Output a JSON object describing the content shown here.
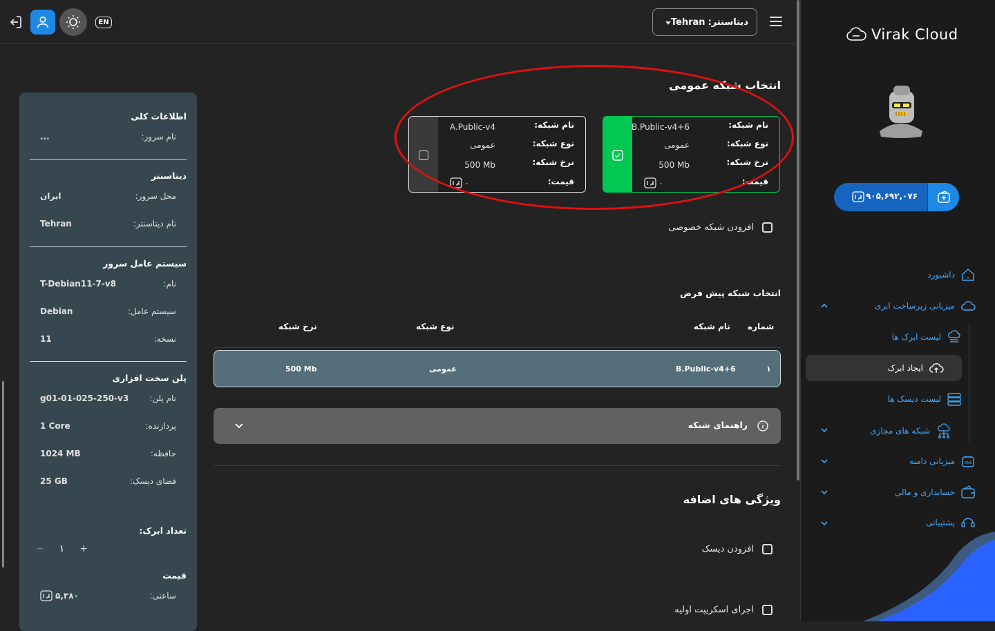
{
  "topbar": {
    "datacenter_label": "دیتاسنتر:",
    "datacenter_value": "Tehran",
    "lang_button": "EN"
  },
  "sidebar": {
    "brand": "Virak Cloud",
    "wallet_balance": "۹۰۵,۶۹۲,۰۷۶",
    "items": [
      {
        "label": "داشبورد",
        "icon": "home-icon"
      },
      {
        "label": "میزبانی زیرساخت ابری",
        "icon": "cloud-icon"
      },
      {
        "label": "لیست ابرک ها",
        "icon": "cloud-list-icon"
      },
      {
        "label": "ایجاد ابرک",
        "icon": "cloud-upload-icon"
      },
      {
        "label": "لیست دیسک ها",
        "icon": "disk-icon"
      },
      {
        "label": "شبکه های مجازی",
        "icon": "network-icon"
      },
      {
        "label": "میزبانی دامنه",
        "icon": "dns-icon"
      },
      {
        "label": "حسابداری و مالی",
        "icon": "wallet-icon"
      },
      {
        "label": "پشتیبانی",
        "icon": "support-icon"
      }
    ]
  },
  "summary": {
    "general_title": "اطلاعات کلی",
    "server_name_label": "نام سرور:",
    "server_name_value": "...",
    "datacenter_title": "دیتاسنتر",
    "location_label": "محل سرور:",
    "location_value": "ایران",
    "dc_name_label": "نام دیتاسنتر:",
    "dc_name_value": "Tehran",
    "os_title": "سیستم عامل سرور",
    "os_name_label": "نام:",
    "os_name_value": "T-Debian11-7-v8",
    "os_label": "سیستم عامل:",
    "os_value": "Debian",
    "version_label": "نسخه:",
    "version_value": "11",
    "plan_title": "پلن سخت افزاری",
    "plan_name_label": "نام پلن:",
    "plan_name_value": "g01-01-025-250-v3",
    "cpu_label": "پردازنده:",
    "cpu_value": "1 Core",
    "ram_label": "حافظه:",
    "ram_value": "1024 MB",
    "disk_label": "فضای دیسک:",
    "disk_value": "25 GB",
    "count_title": "تعداد ابرک:",
    "count_minus": "−",
    "count_value": "۱",
    "count_plus": "+",
    "price_title": "قیمت",
    "hourly_label": "ساعتی:",
    "hourly_value": "۵,۳۸۰"
  },
  "public_network": {
    "title": "انتخاب شبکه عمومی",
    "name_label": "نام شبکه:",
    "type_label": "نوع شبکه:",
    "rate_label": "نرخ شبکه:",
    "price_label": "قیمت:",
    "cards": [
      {
        "name": "B.Public-v4+6",
        "type": "عمومی",
        "rate": "500 Mb",
        "price": "۰",
        "selected": true
      },
      {
        "name": "A.Public-v4",
        "type": "عمومی",
        "rate": "500 Mb",
        "price": "۰",
        "selected": false
      }
    ]
  },
  "private_network": {
    "label": "افزودن شبکه خصوصی"
  },
  "default_network": {
    "title": "انتخاب شبکه پیش فرض",
    "headers": {
      "number": "شماره",
      "name": "نام شبکه",
      "type": "نوع شبکه",
      "rate": "نرخ شبکه"
    },
    "rows": [
      {
        "number": "۱",
        "name": "B.Public-v4+6",
        "type": "عمومی",
        "rate": "500 Mb"
      }
    ]
  },
  "guide": {
    "label": "راهنمای شبکه"
  },
  "extras": {
    "title": "ویژگی های اضافه",
    "add_disk": "افزودن دیسک",
    "init_script": "اجرای اسکریپت اولیه"
  },
  "colors": {
    "accent": "#1e88e5",
    "selected_card": "#00c853",
    "highlight": "#e01010",
    "panel": "#37474f"
  }
}
